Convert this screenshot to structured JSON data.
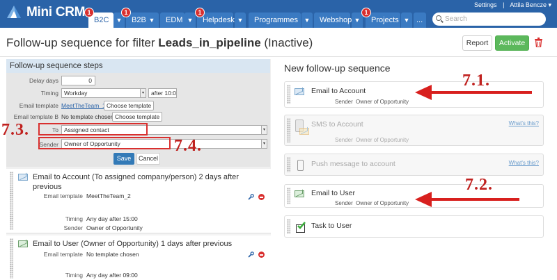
{
  "app": {
    "name": "Mini CRM"
  },
  "topbar": {
    "settings": "Settings",
    "separator": "|",
    "user": "Attila Bencze",
    "search_placeholder": "Search",
    "tabs": [
      {
        "label": "B2C",
        "badge": "1"
      },
      {
        "label": "B2B",
        "badge": "1"
      },
      {
        "label": "EDM"
      },
      {
        "label": "Helpdesk",
        "badge": "1"
      },
      {
        "label": "Programmes"
      },
      {
        "label": "Webshop"
      },
      {
        "label": "Projects",
        "badge": "1"
      },
      {
        "label": "..."
      }
    ]
  },
  "page": {
    "title_prefix": "Follow-up sequence for filter ",
    "filter_name": "Leads_in_pipeline",
    "status": " (Inactive)",
    "report_label": "Report",
    "activate_label": "Activate"
  },
  "left": {
    "header": "Follow-up sequence steps",
    "form": {
      "delay_label": "Delay days",
      "delay_value": "0",
      "timing_label": "Timing",
      "timing_value": "Workday",
      "timing_time": "after 10:0",
      "template_label": "Email template",
      "template_value": "MeetTheTeam_1",
      "choose_template": "Choose template",
      "template_b_label": "Email template B",
      "template_b_value": "No template chosen",
      "to_label": "To",
      "to_value": "Assigned contact",
      "sender_label": "Sender",
      "sender_value": "Owner of Opportunity",
      "save_label": "Save",
      "cancel_label": "Cancel"
    },
    "steps": [
      {
        "title_line1": "Email to Account (To assigned company/person) 2 days after",
        "title_line2": "previous",
        "template_label": "Email template",
        "template_value": "MeetTheTeam_2",
        "timing_label": "Timing",
        "timing_value": "Any day after 15:00",
        "sender_label": "Sender",
        "sender_value": "Owner of Opportunity"
      },
      {
        "title_line1": "Email to User (Owner of Opportunity) 1 days after previous",
        "template_label": "Email template",
        "template_value": "No template chosen",
        "timing_label": "Timing",
        "timing_value": "Any day after 09:00"
      }
    ]
  },
  "right": {
    "header": "New follow-up sequence",
    "cards": [
      {
        "title": "Email to Account",
        "sender_label": "Sender",
        "sender_value": "Owner of Opportunity"
      },
      {
        "title": "SMS to Account",
        "sender_label": "Sender",
        "sender_value": "Owner of Opportunity",
        "whats": "What's this?"
      },
      {
        "title": "Push message to account",
        "whats": "What's this?"
      },
      {
        "title": "Email to User",
        "sender_label": "Sender",
        "sender_value": "Owner of Opportunity"
      },
      {
        "title": "Task to User"
      }
    ]
  },
  "annotations": {
    "a71": "7.1.",
    "a72": "7.2.",
    "a73": "7.3.",
    "a74": "7.4."
  },
  "colors": {
    "topbar": "#2a63a8",
    "tab": "#3a7ac2",
    "badge": "#d9302f",
    "activate": "#5cb85c",
    "annotation": "#c0211f"
  }
}
